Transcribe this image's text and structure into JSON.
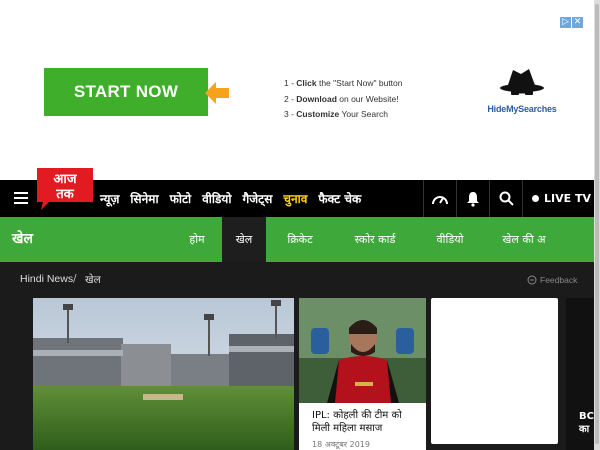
{
  "ad": {
    "start_label": "START NOW",
    "steps": [
      {
        "num": "1 - ",
        "bold": "Click",
        "rest": " the \"Start Now\" button"
      },
      {
        "num": "2 - ",
        "bold": "Download",
        "rest": " on our Website!"
      },
      {
        "num": "3 - ",
        "bold": "Customize",
        "rest": " Your Search"
      }
    ],
    "brand": "HideMySearches",
    "close_glyphs": [
      "▷",
      "✕"
    ]
  },
  "topnav": {
    "logo_text": "आज तक",
    "links": [
      "न्यूज़",
      "सिनेमा",
      "फोटो",
      "वीडियो",
      "गैजेट्स",
      "चुनाव",
      "फैक्ट चेक"
    ],
    "active_link": "चुनाव",
    "live_tv": "LIVE TV",
    "icons": [
      "speedometer-icon",
      "bell-icon",
      "search-icon"
    ]
  },
  "section": {
    "title": "खेल",
    "tabs": [
      "होम",
      "खेल",
      "क्रिकेट",
      "स्कोर कार्ड",
      "वीडियो",
      "खेल की अ"
    ],
    "active_tab": "खेल"
  },
  "breadcrumb": {
    "home": "Hindi News",
    "separator": "/",
    "current": "खेल",
    "feedback": "Feedback"
  },
  "cards": {
    "second_title": "IPL: कोहली की टीम को मिली महिला मसाज",
    "second_date": "18 अक्टूबर 2019",
    "fourth_text": "BC\nका"
  },
  "colors": {
    "accent_green": "#3ea93a",
    "nav_black": "#000000",
    "active_yellow": "#ffd400",
    "logo_red": "#e21b22"
  }
}
